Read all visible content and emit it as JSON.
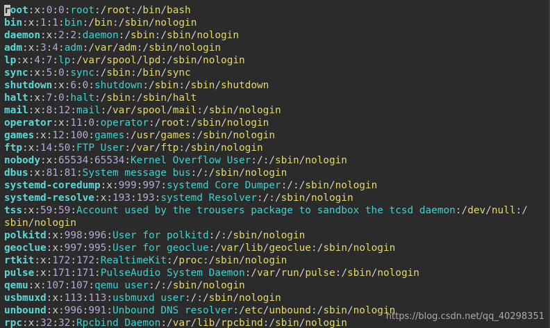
{
  "terminal": {
    "cursor_char": "r",
    "first_user_rest": "oot",
    "lines": [
      {
        "user": "root",
        "uid": "0",
        "gid": "0",
        "gecos": "root",
        "home": "/root",
        "shell": "/bin/bash"
      },
      {
        "user": "bin",
        "uid": "1",
        "gid": "1",
        "gecos": "bin",
        "home": "/bin",
        "shell": "/sbin/nologin"
      },
      {
        "user": "daemon",
        "uid": "2",
        "gid": "2",
        "gecos": "daemon",
        "home": "/sbin",
        "shell": "/sbin/nologin"
      },
      {
        "user": "adm",
        "uid": "3",
        "gid": "4",
        "gecos": "adm",
        "home": "/var/adm",
        "shell": "/sbin/nologin"
      },
      {
        "user": "lp",
        "uid": "4",
        "gid": "7",
        "gecos": "lp",
        "home": "/var/spool/lpd",
        "shell": "/sbin/nologin"
      },
      {
        "user": "sync",
        "uid": "5",
        "gid": "0",
        "gecos": "sync",
        "home": "/sbin",
        "shell": "/bin/sync"
      },
      {
        "user": "shutdown",
        "uid": "6",
        "gid": "0",
        "gecos": "shutdown",
        "home": "/sbin",
        "shell": "/sbin/shutdown"
      },
      {
        "user": "halt",
        "uid": "7",
        "gid": "0",
        "gecos": "halt",
        "home": "/sbin",
        "shell": "/sbin/halt"
      },
      {
        "user": "mail",
        "uid": "8",
        "gid": "12",
        "gecos": "mail",
        "home": "/var/spool/mail",
        "shell": "/sbin/nologin"
      },
      {
        "user": "operator",
        "uid": "11",
        "gid": "0",
        "gecos": "operator",
        "home": "/root",
        "shell": "/sbin/nologin"
      },
      {
        "user": "games",
        "uid": "12",
        "gid": "100",
        "gecos": "games",
        "home": "/usr/games",
        "shell": "/sbin/nologin"
      },
      {
        "user": "ftp",
        "uid": "14",
        "gid": "50",
        "gecos": "FTP User",
        "home": "/var/ftp",
        "shell": "/sbin/nologin"
      },
      {
        "user": "nobody",
        "uid": "65534",
        "gid": "65534",
        "gecos": "Kernel Overflow User",
        "home": "/",
        "shell": "/sbin/nologin"
      },
      {
        "user": "dbus",
        "uid": "81",
        "gid": "81",
        "gecos": "System message bus",
        "home": "/",
        "shell": "/sbin/nologin"
      },
      {
        "user": "systemd-coredump",
        "uid": "999",
        "gid": "997",
        "gecos": "systemd Core Dumper",
        "home": "/",
        "shell": "/sbin/nologin"
      },
      {
        "user": "systemd-resolve",
        "uid": "193",
        "gid": "193",
        "gecos": "systemd Resolver",
        "home": "/",
        "shell": "/sbin/nologin"
      },
      {
        "user": "tss",
        "uid": "59",
        "gid": "59",
        "gecos": "Account used by the trousers package to sandbox the tcsd daemon",
        "home": "/dev/null",
        "shell": "/sbin/nologin",
        "wrap": true
      },
      {
        "user": "polkitd",
        "uid": "998",
        "gid": "996",
        "gecos": "User for polkitd",
        "home": "/",
        "shell": "/sbin/nologin"
      },
      {
        "user": "geoclue",
        "uid": "997",
        "gid": "995",
        "gecos": "User for geoclue",
        "home": "/var/lib/geoclue",
        "shell": "/sbin/nologin"
      },
      {
        "user": "rtkit",
        "uid": "172",
        "gid": "172",
        "gecos": "RealtimeKit",
        "home": "/proc",
        "shell": "/sbin/nologin"
      },
      {
        "user": "pulse",
        "uid": "171",
        "gid": "171",
        "gecos": "PulseAudio System Daemon",
        "home": "/var/run/pulse",
        "shell": "/sbin/nologin"
      },
      {
        "user": "qemu",
        "uid": "107",
        "gid": "107",
        "gecos": "qemu user",
        "home": "/",
        "shell": "/sbin/nologin"
      },
      {
        "user": "usbmuxd",
        "uid": "113",
        "gid": "113",
        "gecos": "usbmuxd user",
        "home": "/",
        "shell": "/sbin/nologin"
      },
      {
        "user": "unbound",
        "uid": "996",
        "gid": "991",
        "gecos": "Unbound DNS resolver",
        "home": "/etc/unbound",
        "shell": "/sbin/nologin"
      },
      {
        "user": "rpc",
        "uid": "32",
        "gid": "32",
        "gecos": "Rpcbind Daemon",
        "home": "/var/lib/rpcbind",
        "shell": "/sbin/nologin"
      }
    ]
  },
  "watermark": "https://blog.csdn.net/qq_40298351",
  "colors": {
    "background": "#2b2b2b",
    "username": "#5fd7d7",
    "numbers": "#b8a8d8",
    "gecos": "#40d0d0",
    "path": "#e6d76b",
    "separator": "#d0d0d0"
  }
}
